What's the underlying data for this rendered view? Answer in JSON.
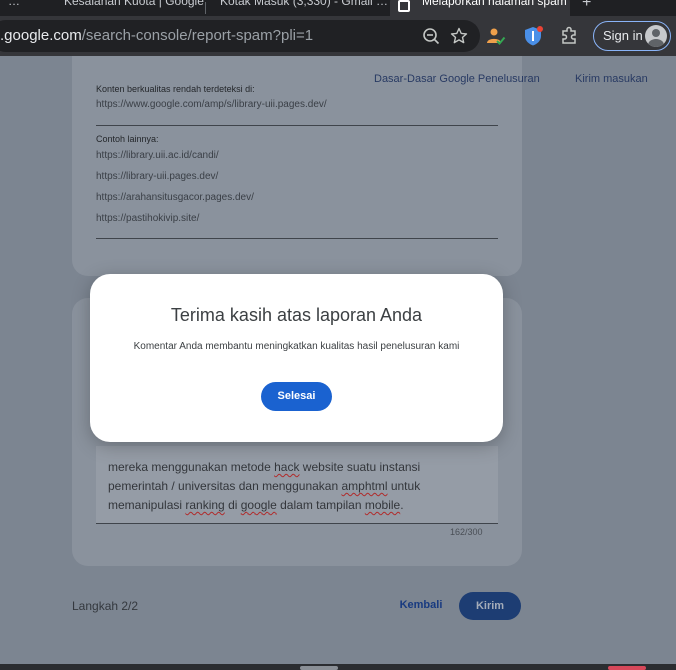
{
  "browser": {
    "tabs": [
      {
        "label": "…"
      },
      {
        "label": "Kesalahan Kuota | Google Search …"
      },
      {
        "label": "Kotak Masuk (3,330) - Gmail …"
      },
      {
        "label": "Melaporkan halaman spam …"
      }
    ],
    "new_tab": "+",
    "url_prefix": ".google.com",
    "url_path": "/search-console/report-spam?pli=1",
    "sign_in_label": "Sign in"
  },
  "page": {
    "top_links": [
      "Dasar-Dasar Google Penelusuran",
      "Kirim masukan"
    ],
    "low_quality_label": "Konten berkualitas rendah terdeteksi di:",
    "low_quality_url": "https://www.google.com/amp/s/library-uii.pages.dev/",
    "examples_label": "Contoh lainnya:",
    "example_urls": [
      "https://library.uii.ac.id/candi/",
      "https://library-uii.pages.dev/",
      "https://arahansitusgacor.pages.dev/",
      "https://pastihokivip.site/"
    ],
    "comment_parts": [
      "mereka menggunakan metode ",
      "hack",
      " website suatu instansi pemerintah / universitas dan menggunakan ",
      "amphtml",
      " untuk memanipulasi ",
      "ranking",
      " di ",
      "google",
      " dalam tampilan ",
      "mobile",
      "."
    ],
    "char_counter": "162/300",
    "step_label": "Langkah 2/2",
    "back_label": "Kembali",
    "submit_label": "Kirim"
  },
  "dialog": {
    "title": "Terima kasih atas laporan Anda",
    "body": "Komentar Anda membantu meningkatkan kualitas hasil penelusuran kami",
    "done_label": "Selesai"
  },
  "colors": {
    "scrim": "#7c8591",
    "primary_button": "#1a62d0",
    "browser_dark": "#35363a"
  }
}
